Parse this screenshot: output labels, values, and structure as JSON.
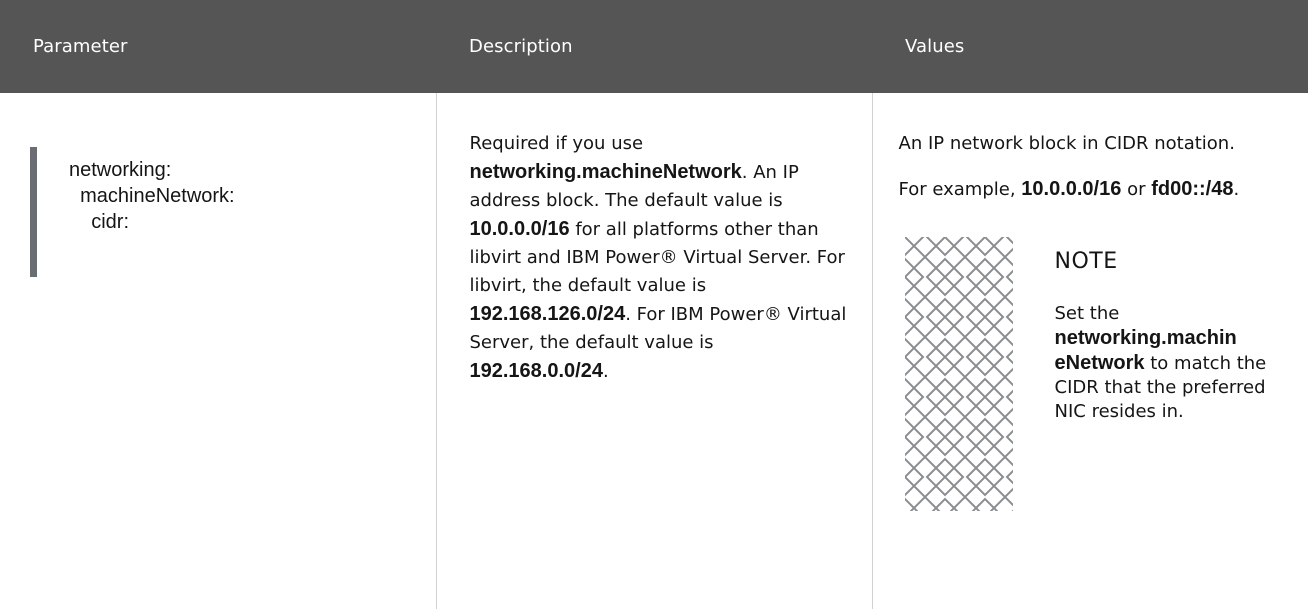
{
  "headers": [
    "Parameter",
    "Description",
    "Values"
  ],
  "parameter": {
    "lines": [
      "networking:",
      "  machineNetwork:",
      "    cidr:"
    ]
  },
  "description": {
    "t1": "Required if you use ",
    "b1": "networking.machineNetwork",
    "t2": ". An IP address block. The default value is ",
    "b2": "10.0.0.0/16",
    "t3": " for all platforms other than libvirt and IBM Power® Virtual Server. For libvirt, the default value is ",
    "b3": "192.168.126.0/24",
    "t4": ". For IBM Power® Virtual Server, the default value is ",
    "b4": "192.168.0.0/24",
    "t5": "."
  },
  "values": {
    "line1": "An IP network block in CIDR notation.",
    "ex_prefix": "For example, ",
    "ex_b1": "10.0.0.0/16",
    "ex_mid": " or ",
    "ex_b2": "fd00::/48",
    "ex_end": "."
  },
  "note": {
    "icon": "note-pattern-icon",
    "title": "NOTE",
    "t1": "Set the ",
    "b1": "networking.machin eNetwork",
    "t2": " to match the CIDR that the preferred NIC resides in."
  },
  "colors": {
    "header_bg": "#555555",
    "bar": "#6a6e73",
    "divider": "#d2d2d2"
  }
}
